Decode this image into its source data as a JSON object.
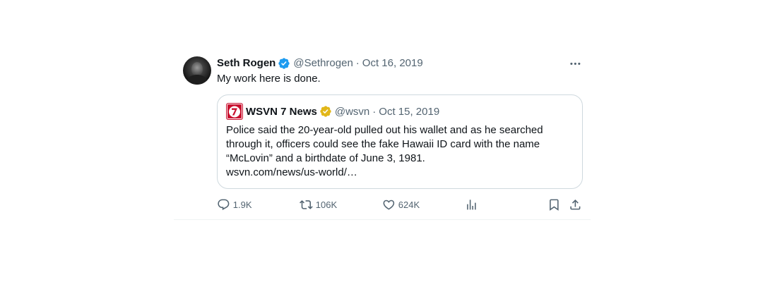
{
  "tweet": {
    "author_name": "Seth Rogen",
    "handle": "@Sethrogen",
    "separator": "·",
    "date": "Oct 16, 2019",
    "text": "My work here is done.",
    "verified_color": "#1d9bf0"
  },
  "quoted_tweet": {
    "author_name": "WSVN 7 News",
    "handle": "@wsvn",
    "separator": "·",
    "date": "Oct 15, 2019",
    "verified_color": "#e2b719",
    "lines": [
      "Police said the 20-year-old pulled out his wallet and as he searched",
      "through it, officers could see the fake Hawaii ID card with the name",
      "“McLovin” and a birthdate of June 3, 1981.",
      "wsvn.com/news/us-world/…"
    ],
    "logo_color": "#c8102e",
    "logo_label": "7"
  },
  "actions": {
    "replies": "1.9K",
    "reposts": "106K",
    "likes": "624K"
  },
  "icons": {
    "more": "more-icon",
    "reply": "reply-icon",
    "repost": "repost-icon",
    "like": "like-icon",
    "views": "views-icon",
    "bookmark": "bookmark-icon",
    "share": "share-icon"
  }
}
